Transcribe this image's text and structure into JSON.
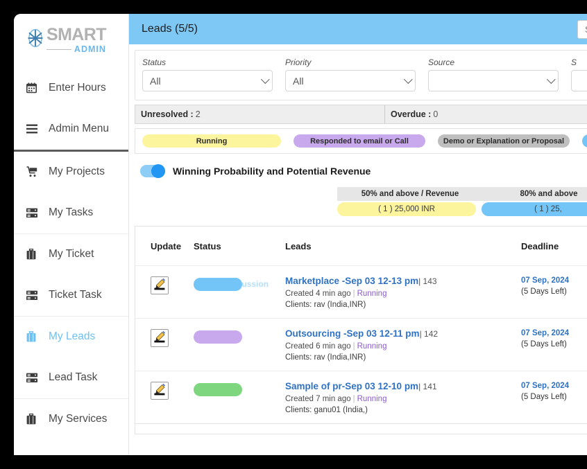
{
  "brand": {
    "title": "SMART",
    "subtitle": "ADMIN",
    "mark": "asterisk-logo-icon"
  },
  "sidebar": {
    "items": [
      {
        "label": "Enter Hours",
        "icon": "calendar-icon",
        "active": false
      },
      {
        "label": "Admin Menu",
        "icon": "hamburger-icon",
        "active": false
      },
      {
        "label": "My Projects",
        "icon": "cart-icon",
        "active": false
      },
      {
        "label": "My Tasks",
        "icon": "server-icon",
        "active": false
      },
      {
        "label": "My Ticket",
        "icon": "briefcase-icon",
        "active": false
      },
      {
        "label": "Ticket Task",
        "icon": "server-icon",
        "active": false
      },
      {
        "label": "My Leads",
        "icon": "briefcase-icon",
        "active": true
      },
      {
        "label": "Lead Task",
        "icon": "server-icon",
        "active": false
      },
      {
        "label": "My Services",
        "icon": "briefcase-icon",
        "active": false
      }
    ]
  },
  "topbar": {
    "title": "Leads (5/5)",
    "search_placeholder": "Search",
    "search_value": "",
    "bg_color": "#7ec8f5"
  },
  "filters": [
    {
      "label": "Status",
      "value": "All"
    },
    {
      "label": "Priority",
      "value": "All"
    },
    {
      "label": "Source",
      "value": ""
    },
    {
      "label": "S",
      "value": ""
    }
  ],
  "counters": [
    {
      "label": "Unresolved :",
      "value": "2"
    },
    {
      "label": "Overdue :",
      "value": "0"
    }
  ],
  "legend": [
    {
      "label": "Running",
      "color": "#fdf59e"
    },
    {
      "label": "Responded to email or Call",
      "color": "#c9a9ee"
    },
    {
      "label": "Demo or Explanation or Proposal",
      "color": "#bfbfbf"
    },
    {
      "label": "",
      "color": "#74c5f7"
    }
  ],
  "winning": {
    "toggle_on": true,
    "label": "Winning Probability and Potential Revenue",
    "buckets": [
      {
        "head": "50% and above / Revenue",
        "bar": "( 1 )  25,000 INR",
        "color": "#fdf59e"
      },
      {
        "head": "80% and above",
        "bar": "( 1 )  25,",
        "color": "#74c5f7"
      }
    ]
  },
  "table": {
    "columns": [
      "Update",
      "Status",
      "Leads",
      "Deadline"
    ],
    "rows": [
      {
        "update_icon": "pencil-edit-icon",
        "status_color": "#74c5f7",
        "status_ghost": "Pricing Discussion",
        "title": "Marketplace -Sep 03 12-13 pm",
        "lead_id": "|  143",
        "created": "Created 4 min ago",
        "state": "Running",
        "clients": "Clients: rav (India,INR)",
        "deadline_date": "07 Sep, 2024",
        "deadline_left": "(5 Days Left)"
      },
      {
        "update_icon": "pencil-edit-icon",
        "status_color": "#c9a9ee",
        "status_ghost": "",
        "title": "Outsourcing -Sep 03 12-11 pm",
        "lead_id": "|  142",
        "created": "Created 6 min ago",
        "state": "Running",
        "clients": "Clients: rav (India,INR)",
        "deadline_date": "07 Sep, 2024",
        "deadline_left": "(5 Days Left)"
      },
      {
        "update_icon": "pencil-edit-icon",
        "status_color": "#7ed77e",
        "status_ghost": "",
        "title": "Sample of pr-Sep 03 12-10 pm",
        "lead_id": "|  141",
        "created": "Created 7 min ago",
        "state": "Running",
        "clients": "Clients: ganu01 (India,)",
        "deadline_date": "07 Sep, 2024",
        "deadline_left": "(5 Days Left)"
      }
    ]
  }
}
